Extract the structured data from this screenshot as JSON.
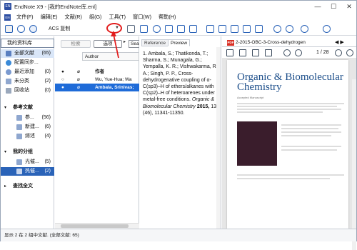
{
  "window": {
    "title": "EndNote X9 - [我的EndNote库.enl]",
    "app_icon": "EN"
  },
  "menu": [
    "文件(F)",
    "编辑(E)",
    "文献(R)",
    "组(G)",
    "工具(T)",
    "窗口(W)",
    "帮助(H)"
  ],
  "toolbar": {
    "style_value": "ACS 复制"
  },
  "library": {
    "my_library": "我的资料库",
    "groups": [
      {
        "label": "全部文献",
        "count": "(65)"
      },
      {
        "label": "配置同步...",
        "count": ""
      },
      {
        "label": "最近添加",
        "count": "(0)"
      },
      {
        "label": "未分类",
        "count": "(2)"
      },
      {
        "label": "回收站",
        "count": "(0)"
      }
    ],
    "section_references": "参考文献",
    "ref_groups": [
      {
        "label": "参...",
        "count": "(56)"
      },
      {
        "label": "新建...",
        "count": "(6)"
      },
      {
        "label": "综述",
        "count": "(4)"
      }
    ],
    "section_my_groups": "我的分组",
    "my_groups": [
      {
        "label": "光催...",
        "count": "(5)"
      },
      {
        "label": "热催...",
        "count": "(2)"
      }
    ],
    "find_fulltext": "查找全文"
  },
  "search": {
    "search_btn": "检索",
    "options_btn": "选项",
    "sea_btn": "Sea",
    "field": "Author"
  },
  "reflist": {
    "header_author": "作者",
    "rows": [
      {
        "author": "Wu, Yue-Hua; Wa",
        "selected": false
      },
      {
        "author": "Ambala, Srinivas;",
        "selected": true
      }
    ]
  },
  "preview": {
    "tab_reference": "Reference",
    "tab_preview": "Preview",
    "citation": "1.        Ambala, S.; Thatikonda, T.;  Sharma, S.;  Munagala, G.; Yempalla, K. R.;  Vishwakarma, R. A.; Singh, P. P., Cross-dehydrogenative coupling of α-C(sp3)–H of ethers/alkanes with C(sp2)–H of heteroarenes under metal-free conditions. ",
    "journal": "Organic & Biomolecular Chemistry",
    "year": "2015,",
    "issue": " 13 (46), 11341-11350."
  },
  "pdf": {
    "badge": "PDF",
    "filename": "2-2015-OBC-3-Cross-dehydrogen",
    "page_current": "1",
    "page_total": "/ 28",
    "journal_title": "Organic & Biomolecular Chemistry",
    "accepted": "Accepted Manuscript"
  },
  "status": "显示 2 在 2 组中文献. (全部文献: 65)",
  "colors": {
    "selection": "#1e6bd8",
    "annotation_red": "#e21c1c",
    "journal_blue": "#1b4d89"
  }
}
